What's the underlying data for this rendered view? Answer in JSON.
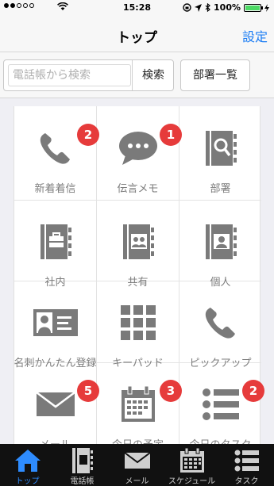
{
  "status_bar": {
    "time": "15:28",
    "battery": "100%"
  },
  "nav": {
    "title": "トップ",
    "settings": "設定"
  },
  "search": {
    "placeholder": "電話帳から検索",
    "button": "検索",
    "dept_button": "部署一覧"
  },
  "grid": {
    "items": [
      {
        "label": "新着着信",
        "icon": "phone-icon",
        "badge": "2"
      },
      {
        "label": "伝言メモ",
        "icon": "speech-bubble-icon",
        "badge": "1"
      },
      {
        "label": "部署",
        "icon": "directory-search-icon"
      },
      {
        "label": "社内",
        "icon": "company-book-icon"
      },
      {
        "label": "共有",
        "icon": "shared-book-icon"
      },
      {
        "label": "個人",
        "icon": "personal-book-icon"
      },
      {
        "label": "名刺かんたん登録",
        "icon": "business-card-icon"
      },
      {
        "label": "キーパッド",
        "icon": "keypad-icon"
      },
      {
        "label": "ピックアップ",
        "icon": "pickup-phone-icon"
      },
      {
        "label": "メール",
        "icon": "mail-icon",
        "badge": "5"
      },
      {
        "label": "今日の予定",
        "icon": "calendar-icon",
        "badge": "3"
      },
      {
        "label": "今日のタスク",
        "icon": "task-list-icon",
        "badge": "2"
      }
    ]
  },
  "tabs": [
    {
      "label": "トップ",
      "icon": "home-icon",
      "active": true
    },
    {
      "label": "電話帳",
      "icon": "phonebook-icon"
    },
    {
      "label": "メール",
      "icon": "mail-icon"
    },
    {
      "label": "スケジュール",
      "icon": "calendar-icon"
    },
    {
      "label": "タスク",
      "icon": "task-list-icon"
    }
  ],
  "colors": {
    "icon_gray": "#7a7a7a",
    "badge_red": "#e63b3b",
    "accent_blue": "#1a7cf4",
    "tab_active": "#2e8cff",
    "tab_bg": "#111111"
  }
}
